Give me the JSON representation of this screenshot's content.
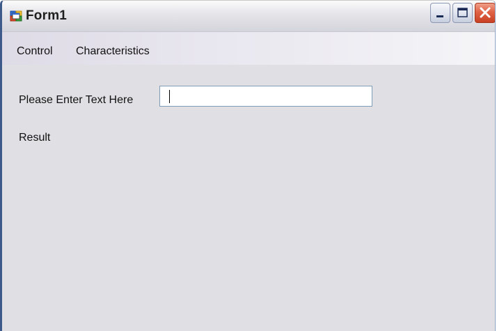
{
  "window": {
    "title": "Form1",
    "app_icon": "form-app-icon",
    "controls": {
      "minimize_icon": "minimize-icon",
      "maximize_icon": "maximize-icon",
      "close_icon": "close-icon"
    }
  },
  "menu": {
    "items": [
      {
        "label": "Control"
      },
      {
        "label": "Characteristics"
      }
    ]
  },
  "form": {
    "prompt_label": "Please Enter Text Here",
    "text_input": {
      "value": "",
      "placeholder": ""
    },
    "result_label": "Result"
  },
  "colors": {
    "client_background": "#e0dfe3",
    "close_button": "#e06346",
    "input_border": "#7f9db9"
  }
}
